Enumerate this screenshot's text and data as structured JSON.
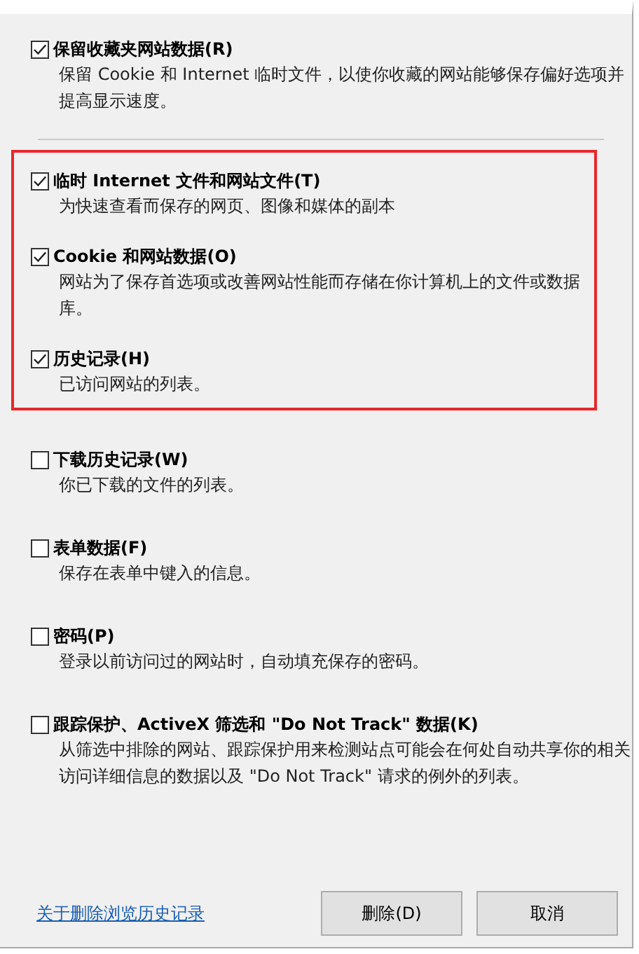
{
  "options": [
    {
      "label": "保留收藏夹网站数据(R)",
      "description": "保留 Cookie 和 Internet 临时文件，以使你收藏的网站能够保存偏好选项并提高显示速度。",
      "checked": true,
      "highlighted": false,
      "divider_after": true
    },
    {
      "label": "临时 Internet 文件和网站文件(T)",
      "description": "为快速查看而保存的网页、图像和媒体的副本",
      "checked": true,
      "highlighted": true,
      "divider_after": false
    },
    {
      "label": "Cookie 和网站数据(O)",
      "description": "网站为了保存首选项或改善网站性能而存储在你计算机上的文件或数据库。",
      "checked": true,
      "highlighted": true,
      "divider_after": false
    },
    {
      "label": "历史记录(H)",
      "description": "已访问网站的列表。",
      "checked": true,
      "highlighted": true,
      "divider_after": false
    },
    {
      "label": "下载历史记录(W)",
      "description": "你已下载的文件的列表。",
      "checked": false,
      "highlighted": false,
      "divider_after": false
    },
    {
      "label": "表单数据(F)",
      "description": "保存在表单中键入的信息。",
      "checked": false,
      "highlighted": false,
      "divider_after": false
    },
    {
      "label": "密码(P)",
      "description": "登录以前访问过的网站时，自动填充保存的密码。",
      "checked": false,
      "highlighted": false,
      "divider_after": false
    },
    {
      "label": "跟踪保护、ActiveX 筛选和 \"Do Not Track\" 数据(K)",
      "description": "从筛选中排除的网站、跟踪保护用来检测站点可能会在何处自动共享你的相关访问详细信息的数据以及 \"Do Not Track\" 请求的例外的列表。",
      "checked": false,
      "highlighted": false,
      "divider_after": false
    }
  ],
  "footer": {
    "link": "关于删除浏览历史记录",
    "buttons": [
      "删除(D)",
      "取消"
    ]
  }
}
